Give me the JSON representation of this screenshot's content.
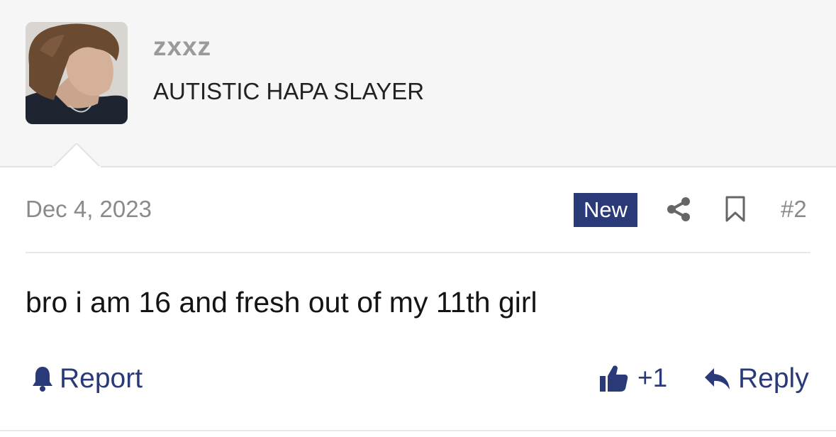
{
  "post": {
    "username": "zxxz",
    "user_title": "AUTISTIC HAPA SLAYER",
    "date": "Dec 4, 2023",
    "badge": "New",
    "post_number": "#2",
    "content": "bro i am 16 and fresh out of my 11th girl"
  },
  "actions": {
    "report_label": "Report",
    "like_count": "+1",
    "reply_label": "Reply"
  },
  "colors": {
    "accent": "#2a3a78",
    "muted_text": "#8a8a8a",
    "header_bg": "#f6f6f6"
  },
  "icons": {
    "share": "share-icon",
    "bookmark": "bookmark-icon",
    "report": "bell-icon",
    "like": "thumbs-up-icon",
    "reply": "reply-arrow-icon"
  }
}
